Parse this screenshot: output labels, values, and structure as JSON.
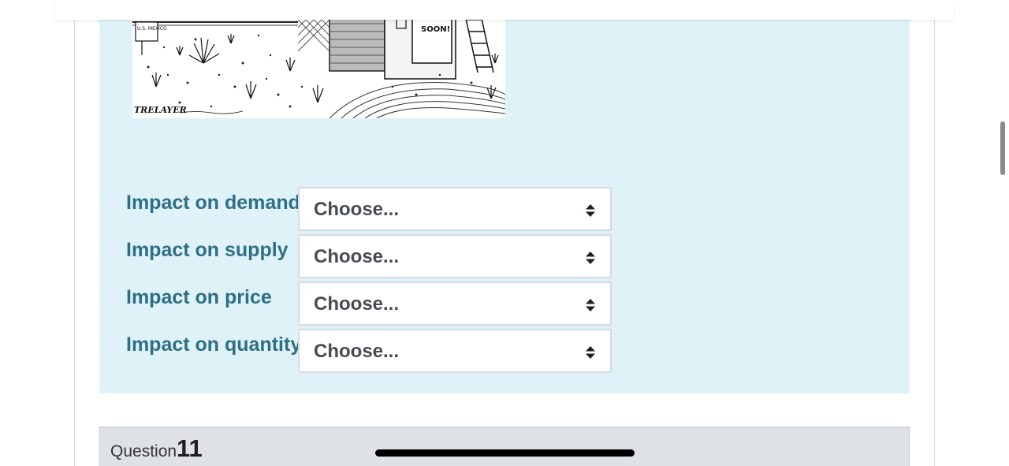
{
  "cartoon": {
    "sign_text": "U.S. MEXICO",
    "banner_text": "SOON!",
    "signature_text": "TRELAYER"
  },
  "impacts": [
    {
      "label": "Impact on demand",
      "selected": "Choose..."
    },
    {
      "label": "Impact on supply",
      "selected": "Choose..."
    },
    {
      "label": "Impact on price",
      "selected": "Choose..."
    },
    {
      "label": "Impact on quantity",
      "selected": "Choose..."
    }
  ],
  "next_question": {
    "word": "Question",
    "number": "11"
  },
  "icons": {
    "select_arrows": "sort-arrows-icon",
    "scrollbar": "scrollbar-thumb",
    "home_indicator": "home-indicator-bar"
  },
  "colors": {
    "panel_background": "#def2f8",
    "label_color": "#2e6f85",
    "header_background": "#dee2e6"
  }
}
